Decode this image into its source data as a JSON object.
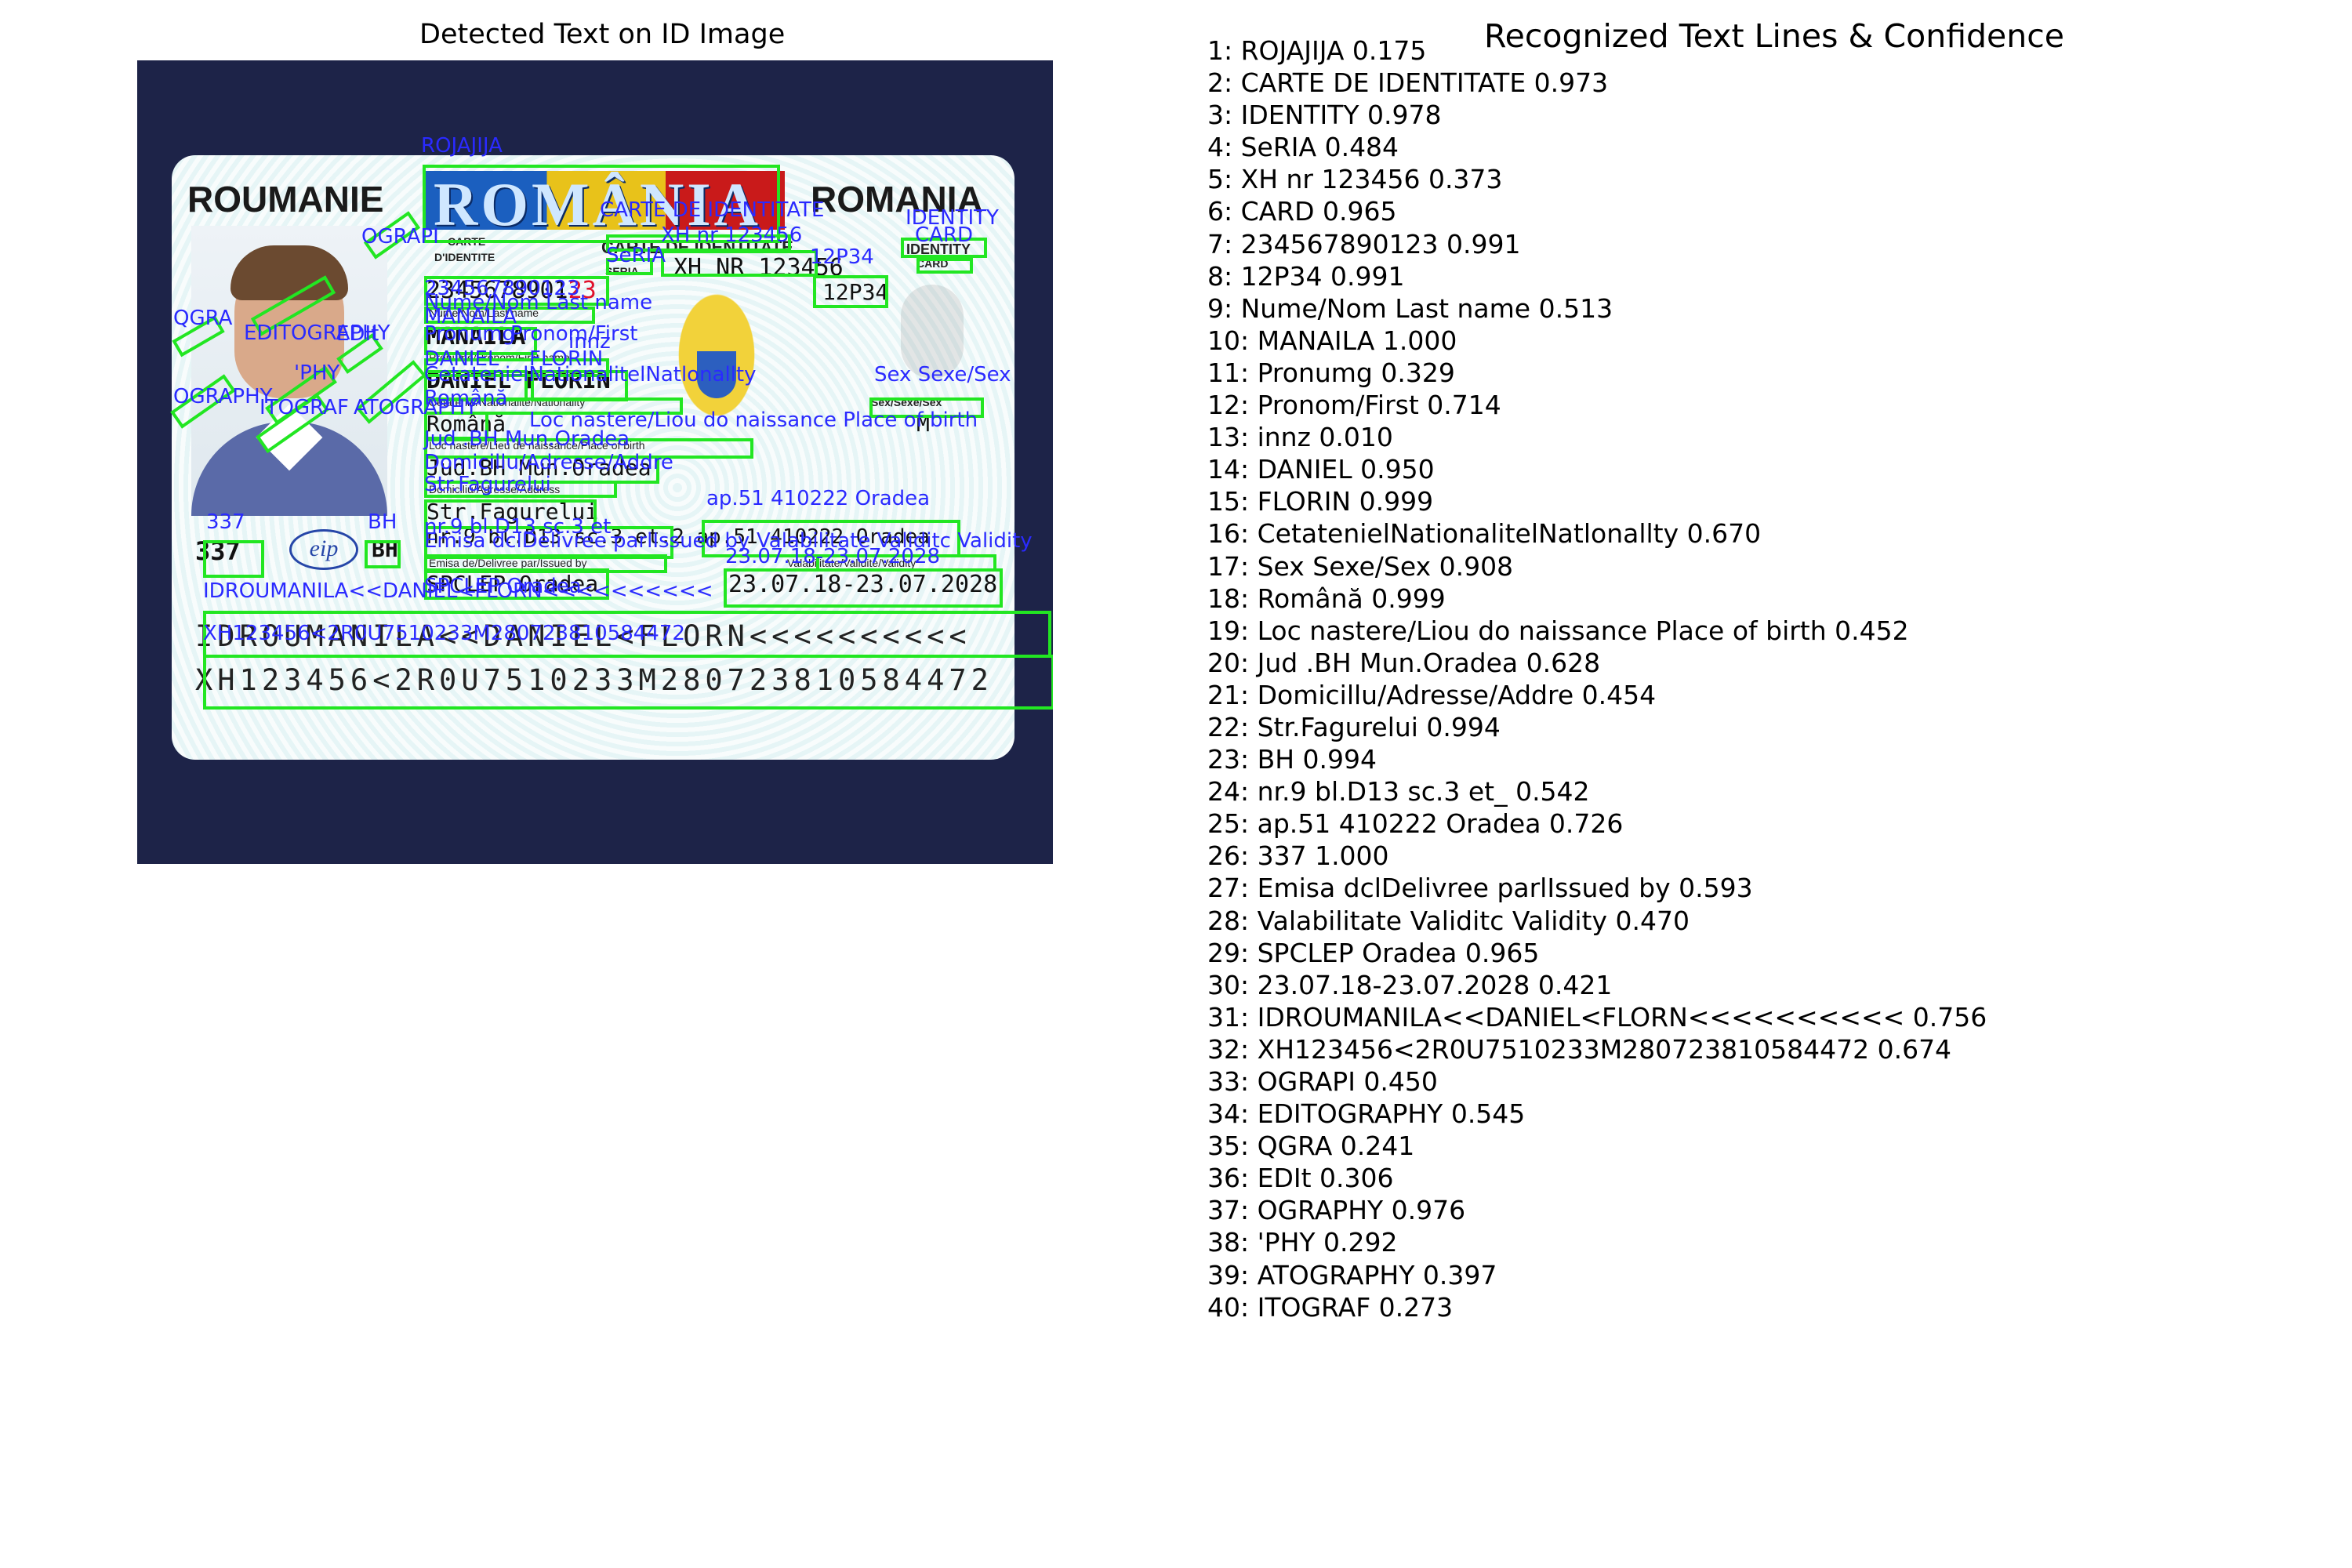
{
  "left_title": "Detected Text on ID Image",
  "right_title": "Recognized Text Lines & Confidence",
  "card": {
    "country_left": "ROUMANIE",
    "country_right": "ROMANIA",
    "banner": "ROMÂNIA",
    "carte": "CARTE",
    "didentite": "D'IDENTITE",
    "carte_identitate": "CARTE DE IDENTITATE",
    "identity": "IDENTITY",
    "card_word": "CARD",
    "seria": "SERIA",
    "series_nr": "XH NR 123456",
    "cnp": "2345678901",
    "cnp_red": "23",
    "cod": "12P34",
    "name_label": "Nume/Nom/Last name",
    "last_name": "MANAILA",
    "prenume_label": "Prenume/Prenom/First name",
    "first_names": "DANIEL FLORIN",
    "citizenship_label": "Cetatenie/Nationalite/Nationality",
    "sex_label": "Sex/Sexe/Sex",
    "citizenship": "Română",
    "sex": "M",
    "birth_label": "Loc nastere/Lieu de naissance/Place of birth",
    "birth_place": "Jud.BH Mun.Oradea",
    "address_label": "Domiciliu/Adresse/Address",
    "street": "Str.Fagurelui",
    "address_line": "nr.9 bl.D13 sc.3 et.2 ap.51 410222 Oradea",
    "issued_label": "Emisa de/Delivree par/Issued by",
    "issued_by": "SPCLEP Oradea",
    "validity_label": "Valabilitate/Validite/Validity",
    "validity": "23.07.18-23.07.2028",
    "code_num": "337",
    "county": "BH",
    "logo": "eip",
    "mrz1": "IDROUMANILA<<DANIEL<FLORN<<<<<<<<<<",
    "mrz2": "XH123456<2R0U7510233M280723810584472"
  },
  "overlay_labels": {
    "rojajija": "ROJAJIJA",
    "carte_ident": "CARTE DE IDENTITATE",
    "identity": "IDENTITY",
    "card": "CARD",
    "seria": "SeRIA",
    "xh": "XH nr 123456",
    "cnp": "234567890123",
    "p34": "12P34",
    "nume": "Nume/Nom Last name",
    "manaila": "MANAILA",
    "pronumg": "Pronumg",
    "pronom": "Pronom/First",
    "innz": "innz",
    "daniel": "DANIEL",
    "florin": "FLORIN",
    "citizen": "CetatenielNationalitelNatlonallty",
    "sex": "Sex Sexe/Sex",
    "romana": "Română",
    "birth": "Loc nastere/Liou do naissance Place of birth",
    "jud": "Jud .BH Mun.Oradea",
    "domic": "Domicillu/Adresse/Addre",
    "street": "Str.Fagurelui",
    "bh": "BH",
    "nr9": "nr.9 bl.D13 sc.3 et_",
    "ap51": "ap.51 410222 Oradea",
    "n337": "337",
    "emisa": "Emisa dclDelivree parlIssued by",
    "valab": "Valabilitate Validitc Validity",
    "spclep": "SPCLEP Oradea",
    "dates": "23.07.18-23.07.2028",
    "mrz1": "IDROUMANILA<<DANIEL<FLORN<<<<<<<<<<",
    "mrz2": "XH123456<2R0U7510233M280723810584472",
    "ograpi": "OGRAPI",
    "editography": "EDITOGRAPHY",
    "qgra": "QGRA",
    "edit": "EDIt",
    "ography": "OGRAPHY",
    "phy": "'PHY",
    "atography": "ATOGRAPHY",
    "itograf": "ITOGRAF"
  },
  "recognized_lines": [
    "1: ROJAJIJA  0.175",
    "2: CARTE DE IDENTITATE  0.973",
    "3: IDENTITY  0.978",
    "4: SeRIA  0.484",
    "5: XH nr 123456  0.373",
    "6: CARD  0.965",
    "7: 234567890123  0.991",
    "8: 12P34  0.991",
    "9: Nume/Nom Last name  0.513",
    "10: MANAILA  1.000",
    "11: Pronumg  0.329",
    "12: Pronom/First  0.714",
    "13: innz  0.010",
    "14: DANIEL  0.950",
    "15: FLORIN  0.999",
    "16: CetatenielNationalitelNatlonallty  0.670",
    "17: Sex Sexe/Sex  0.908",
    "18: Română  0.999",
    "19: Loc nastere/Liou do naissance Place of birth  0.452",
    "20: Jud .BH Mun.Oradea  0.628",
    "21: Domicillu/Adresse/Addre  0.454",
    "22: Str.Fagurelui  0.994",
    "23: BH  0.994",
    "24: nr.9 bl.D13 sc.3 et_  0.542",
    "25: ap.51 410222 Oradea  0.726",
    "26: 337  1.000",
    "27: Emisa dclDelivree parlIssued by  0.593",
    "28: Valabilitate Validitc Validity  0.470",
    "29: SPCLEP Oradea  0.965",
    "30: 23.07.18-23.07.2028  0.421",
    "31: IDROUMANILA<<DANIEL<FLORN<<<<<<<<<<  0.756",
    "32: XH123456<2R0U7510233M280723810584472  0.674",
    "33: OGRAPI  0.450",
    "34: EDITOGRAPHY  0.545",
    "35: QGRA  0.241",
    "36: EDIt  0.306",
    "37: OGRAPHY  0.976",
    "38: 'PHY  0.292",
    "39: ATOGRAPHY  0.397",
    "40: ITOGRAF  0.273"
  ],
  "colors": {
    "box": "#22e622",
    "label": "#2a2aff",
    "background": "#1d2348"
  }
}
